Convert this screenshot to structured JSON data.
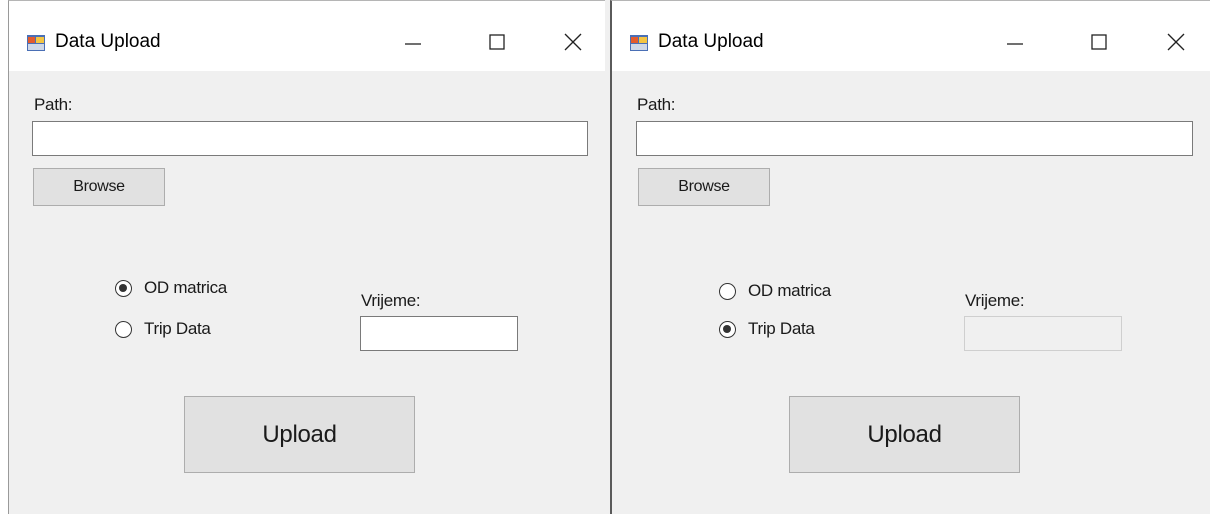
{
  "windows": [
    {
      "title": "Data Upload",
      "path_label": "Path:",
      "path_value": "",
      "browse_label": "Browse",
      "radios": [
        {
          "label": "OD matrica",
          "checked": true
        },
        {
          "label": "Trip Data",
          "checked": false
        }
      ],
      "time_label": "Vrijeme:",
      "time_value": "",
      "time_enabled": true,
      "upload_label": "Upload"
    },
    {
      "title": "Data Upload",
      "path_label": "Path:",
      "path_value": "",
      "browse_label": "Browse",
      "radios": [
        {
          "label": "OD matrica",
          "checked": false
        },
        {
          "label": "Trip Data",
          "checked": true
        }
      ],
      "time_label": "Vrijeme:",
      "time_value": "",
      "time_enabled": false,
      "upload_label": "Upload"
    }
  ],
  "icons": {
    "app": "app-window-icon",
    "minimize": "minimize-icon",
    "maximize": "maximize-icon",
    "close": "close-icon"
  }
}
